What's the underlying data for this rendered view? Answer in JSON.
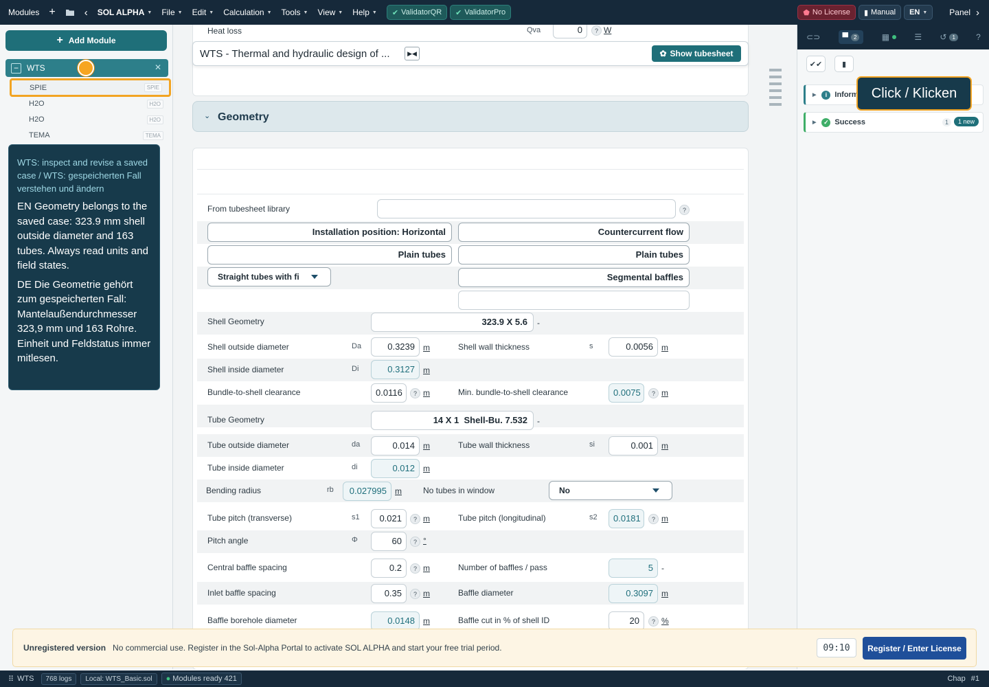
{
  "topbar": {
    "modules": "Modules",
    "plus": "+",
    "back": "‹",
    "app": "SOL ALPHA",
    "menus": [
      "File",
      "Edit",
      "Calculation",
      "Tools",
      "View",
      "Help"
    ],
    "validator1": "ValidatorQR",
    "validator2": "ValidatorPro",
    "license": "No License",
    "manual": "Manual",
    "lang": "EN",
    "panel": "Panel",
    "next": "›"
  },
  "sidebar": {
    "add": "Add Module",
    "wts": "WTS",
    "tree": [
      {
        "label": "SPIE",
        "tag": "SPIE"
      },
      {
        "label": "H2O",
        "tag": "H2O"
      },
      {
        "label": "H2O",
        "tag": "H2O"
      },
      {
        "label": "TEMA",
        "tag": "TEMA"
      }
    ]
  },
  "tooltip": {
    "head": "WTS: inspect and revise a saved case / WTS: gespeicherten Fall verstehen und ändern",
    "en": "EN Geometry belongs to the saved case: 323.9 mm shell outside diameter and 163 tubes. Always read units and field states.",
    "de": "DE Die Geometrie gehört zum gespeicherten Fall: Mantelaußendurchmesser 323,9 mm und 163 Rohre. Einheit und Feldstatus immer mitlesen."
  },
  "main": {
    "heat_loss": "Heat loss",
    "qva": "Qva",
    "qva_val": "0",
    "qva_unit": "W",
    "title": "WTS - Thermal and hydraulic design of ...",
    "show_tubesheet": "Show tubesheet",
    "geometry": "Geometry",
    "tubesheet_lib": "From tubesheet library",
    "opt_install": "Installation position: Horizontal",
    "opt_flow": "Countercurrent flow",
    "opt_plain1": "Plain tubes",
    "opt_plain2": "Plain tubes",
    "opt_tubetype": "Straight tubes with fix",
    "opt_baffles": "Segmental baffles",
    "shell_geom": "Shell Geometry",
    "shell_geom_val": "323.9 X 5.6",
    "shell_od": "Shell outside diameter",
    "da_sym": "Da",
    "da_val": "0.3239",
    "shell_wall": "Shell wall thickness",
    "s_sym": "s",
    "s_val": "0.0056",
    "shell_id": "Shell inside diameter",
    "di_sym": "Di",
    "di_val": "0.3127",
    "bundle": "Bundle-to-shell clearance",
    "bundle_val": "0.0116",
    "min_bundle": "Min. bundle-to-shell clearance",
    "min_bundle_val": "0.0075",
    "tube_geom": "Tube Geometry",
    "tube_geom_val": "14 X 1  Shell-Bu. 7.532",
    "tube_od": "Tube outside diameter",
    "da2_sym": "da",
    "da2_val": "0.014",
    "tube_wall": "Tube wall thickness",
    "si_sym": "si",
    "si_val": "0.001",
    "tube_id": "Tube inside diameter",
    "di2_sym": "di",
    "di2_val": "0.012",
    "bending": "Bending radius",
    "rb_sym": "rb",
    "rb_val": "0.027995",
    "no_tubes": "No tubes in window",
    "no_tubes_val": "No",
    "pitch_t": "Tube pitch (transverse)",
    "s1_sym": "s1",
    "s1_val": "0.021",
    "pitch_l": "Tube pitch (longitudinal)",
    "s2_sym": "s2",
    "s2_val": "0.0181",
    "pitch_angle": "Pitch angle",
    "phi_sym": "Φ",
    "phi_val": "60",
    "phi_unit": "°",
    "central_baffle": "Central baffle spacing",
    "central_val": "0.2",
    "num_baffles": "Number of baffles / pass",
    "num_baffles_val": "5",
    "inlet_baffle": "Inlet baffle spacing",
    "inlet_val": "0.35",
    "baffle_dia": "Baffle diameter",
    "baffle_dia_val": "0.3097",
    "borehole": "Baffle borehole diameter",
    "borehole_val": "0.0148",
    "baffle_cut": "Baffle cut in % of shell ID",
    "baffle_cut_val": "20",
    "pct": "%",
    "m": "m",
    "dash": "-",
    "q": "?"
  },
  "right": {
    "tab2_badge": "2",
    "tab5_badge": "1",
    "info": "Inform",
    "success": "Success",
    "success_count": "1",
    "success_new": "1 new",
    "click": "Click / Klicken"
  },
  "banner": {
    "bold": "Unregistered version",
    "text": "No commercial use. Register in the Sol-Alpha Portal to activate SOL ALPHA and start your free trial period.",
    "timer": "09:10",
    "register": "Register / Enter License"
  },
  "status": {
    "wts": "WTS",
    "logs": "768 logs",
    "local": "Local: WTS_Basic.sol",
    "ready": "Modules ready",
    "ready_n": "421",
    "chap": "Chap",
    "chap_n": "#1"
  }
}
